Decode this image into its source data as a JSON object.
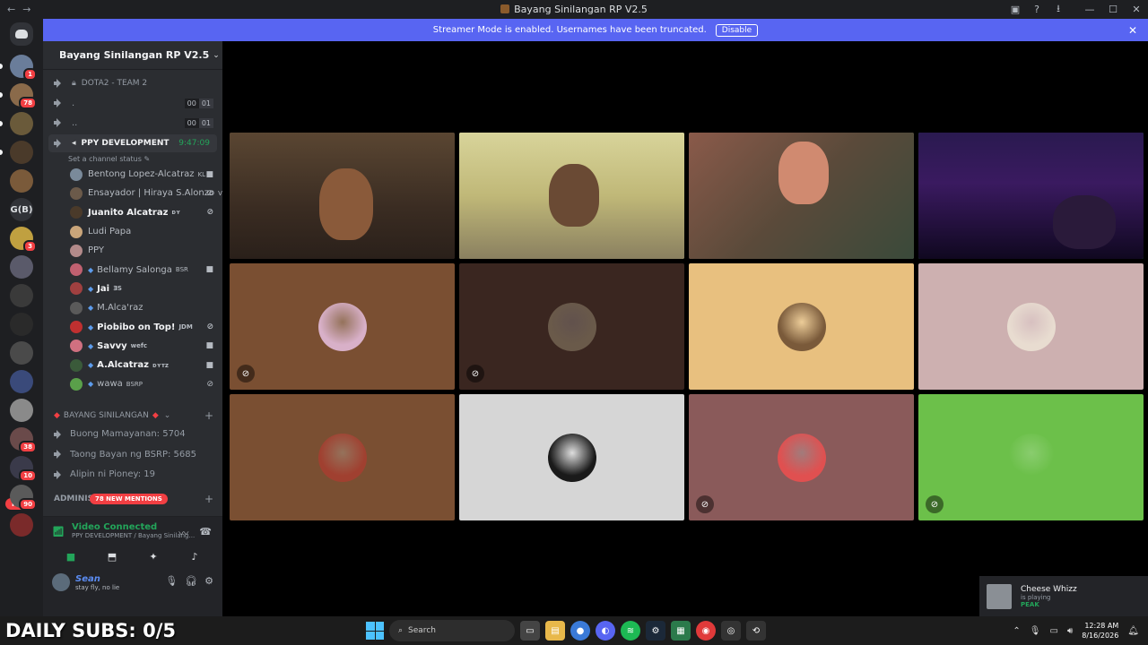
{
  "window": {
    "title": "Bayang Sinilangan RP V2.5",
    "back_icon": "arrow-left",
    "forward_icon": "arrow-right"
  },
  "streamer_mode": {
    "message": "Streamer Mode is enabled. Usernames have been truncated.",
    "disable_label": "Disable"
  },
  "rail": {
    "servers": [
      {
        "badge": "1"
      },
      {
        "badge": "78"
      },
      {
        "badge": ""
      },
      {
        "badge": ""
      },
      {
        "badge": ""
      },
      {
        "label": "G(B)"
      },
      {
        "badge": "3"
      },
      {
        "badge": ""
      },
      {
        "badge": ""
      },
      {
        "badge": ""
      },
      {
        "badge": ""
      },
      {
        "badge": ""
      },
      {
        "badge": ""
      },
      {
        "badge": "38"
      },
      {
        "badge": "10"
      },
      {
        "badge": "90"
      },
      {
        "badge": ""
      }
    ],
    "new_label": "NEW"
  },
  "guild": {
    "name": "Bayang Sinilangan RP V2.5"
  },
  "channels": {
    "dota": "DOTA2 - TEAM 2",
    "dot1": ".",
    "dot2": "..",
    "limit_a": "00",
    "limit_b": "01",
    "active_name": "PPY DEVELOPMENT",
    "active_timer": "9:47:09",
    "set_status": "Set a channel status",
    "members": [
      {
        "name": "Bentong Lopez-Alcatraz",
        "tag": "KL",
        "color": "#7a8a9a",
        "bold": false,
        "gem": false,
        "icon": "cam"
      },
      {
        "name": "Ensayador | Hiraya S.Alonzo",
        "tag": "V",
        "color": "#6b5a4a",
        "bold": false,
        "gem": false,
        "icon": "mute"
      },
      {
        "name": "Juanito Alcatraz",
        "tag": "ᴅʏ",
        "color": "#4a3a2a",
        "bold": true,
        "gem": false,
        "icon": "mute"
      },
      {
        "name": "Ludi Papa",
        "tag": "",
        "color": "#c9a57a",
        "bold": false,
        "gem": false,
        "icon": ""
      },
      {
        "name": "PPY",
        "tag": "",
        "color": "#b38a8a",
        "bold": false,
        "gem": false,
        "icon": ""
      },
      {
        "name": "Bellamy Salonga",
        "tag": "BSR",
        "color": "#c06070",
        "bold": false,
        "gem": true,
        "icon": "cam"
      },
      {
        "name": "Jai",
        "tag": "ƎS",
        "color": "#a04040",
        "bold": true,
        "gem": true,
        "icon": ""
      },
      {
        "name": "M.Alca'raz",
        "tag": "",
        "color": "#5a5a5a",
        "bold": false,
        "gem": true,
        "icon": ""
      },
      {
        "name": "Piobibo on Top!",
        "tag": "JDM",
        "color": "#c03030",
        "bold": true,
        "gem": true,
        "icon": "mute"
      },
      {
        "name": "Savvy",
        "tag": "wefc",
        "color": "#d07080",
        "bold": true,
        "gem": true,
        "icon": "cam"
      },
      {
        "name": "A.Alcatraz",
        "tag": "ᴅʏᴛᴢ",
        "color": "#3a5a3a",
        "bold": true,
        "gem": true,
        "icon": "cam"
      },
      {
        "name": "wawa",
        "tag": "BSRP",
        "color": "#5aa04a",
        "bold": false,
        "gem": true,
        "icon": "mute"
      }
    ],
    "category": "BAYANG SINILANGAN",
    "stats": [
      "Buong Mamayanan: 5704",
      "Taong Bayan ng BSRP: 5685",
      "Alipin ni Pioney: 19"
    ],
    "admin_category": "ADMINISTR",
    "mentions": "78 NEW MENTIONS"
  },
  "voice": {
    "status": "Video Connected",
    "location": "PPY DEVELOPMENT / Bayang Sinilang..."
  },
  "user": {
    "name": "Sean",
    "status": "stay fly, no lie"
  },
  "tiles": [
    {
      "kind": "cam",
      "bg": "#4a3a2e",
      "muted": false,
      "speaking": false
    },
    {
      "kind": "cam",
      "bg": "#c8c48a",
      "muted": false,
      "speaking": false
    },
    {
      "kind": "cam",
      "bg": "#6b5a4a",
      "muted": false,
      "speaking": false
    },
    {
      "kind": "cam",
      "bg": "#1a1030",
      "muted": false,
      "speaking": true
    },
    {
      "kind": "avatar",
      "bg": "#7a4f32",
      "av": "#d8b0c8",
      "muted": true,
      "speaking": false
    },
    {
      "kind": "avatar",
      "bg": "#3a2620",
      "av": "#6a5a4a",
      "muted": true,
      "speaking": false
    },
    {
      "kind": "avatar",
      "bg": "#e8c07f",
      "av": "#7a5a3a",
      "muted": false,
      "speaking": false
    },
    {
      "kind": "avatar",
      "bg": "#cdb0b0",
      "av": "#e8dcd0",
      "muted": false,
      "speaking": false
    },
    {
      "kind": "avatar",
      "bg": "#7a4f32",
      "av": "#a04030",
      "muted": false,
      "speaking": false
    },
    {
      "kind": "avatar",
      "bg": "#d6d6d6",
      "av": "#1a1a1a",
      "muted": false,
      "speaking": false
    },
    {
      "kind": "avatar",
      "bg": "#8a5a5a",
      "av": "#e05050",
      "muted": true,
      "speaking": false
    },
    {
      "kind": "avatar",
      "bg": "#6cc04a",
      "av": "#6cc04a",
      "muted": true,
      "speaking": false
    }
  ],
  "toast": {
    "name": "Cheese Whizz",
    "activity": "is playing",
    "game": "PEAK"
  },
  "taskbar": {
    "overlay": "DAILY SUBS: 0/5",
    "search": "Search",
    "time": "12:28 AM",
    "date": "8/16/2026"
  }
}
